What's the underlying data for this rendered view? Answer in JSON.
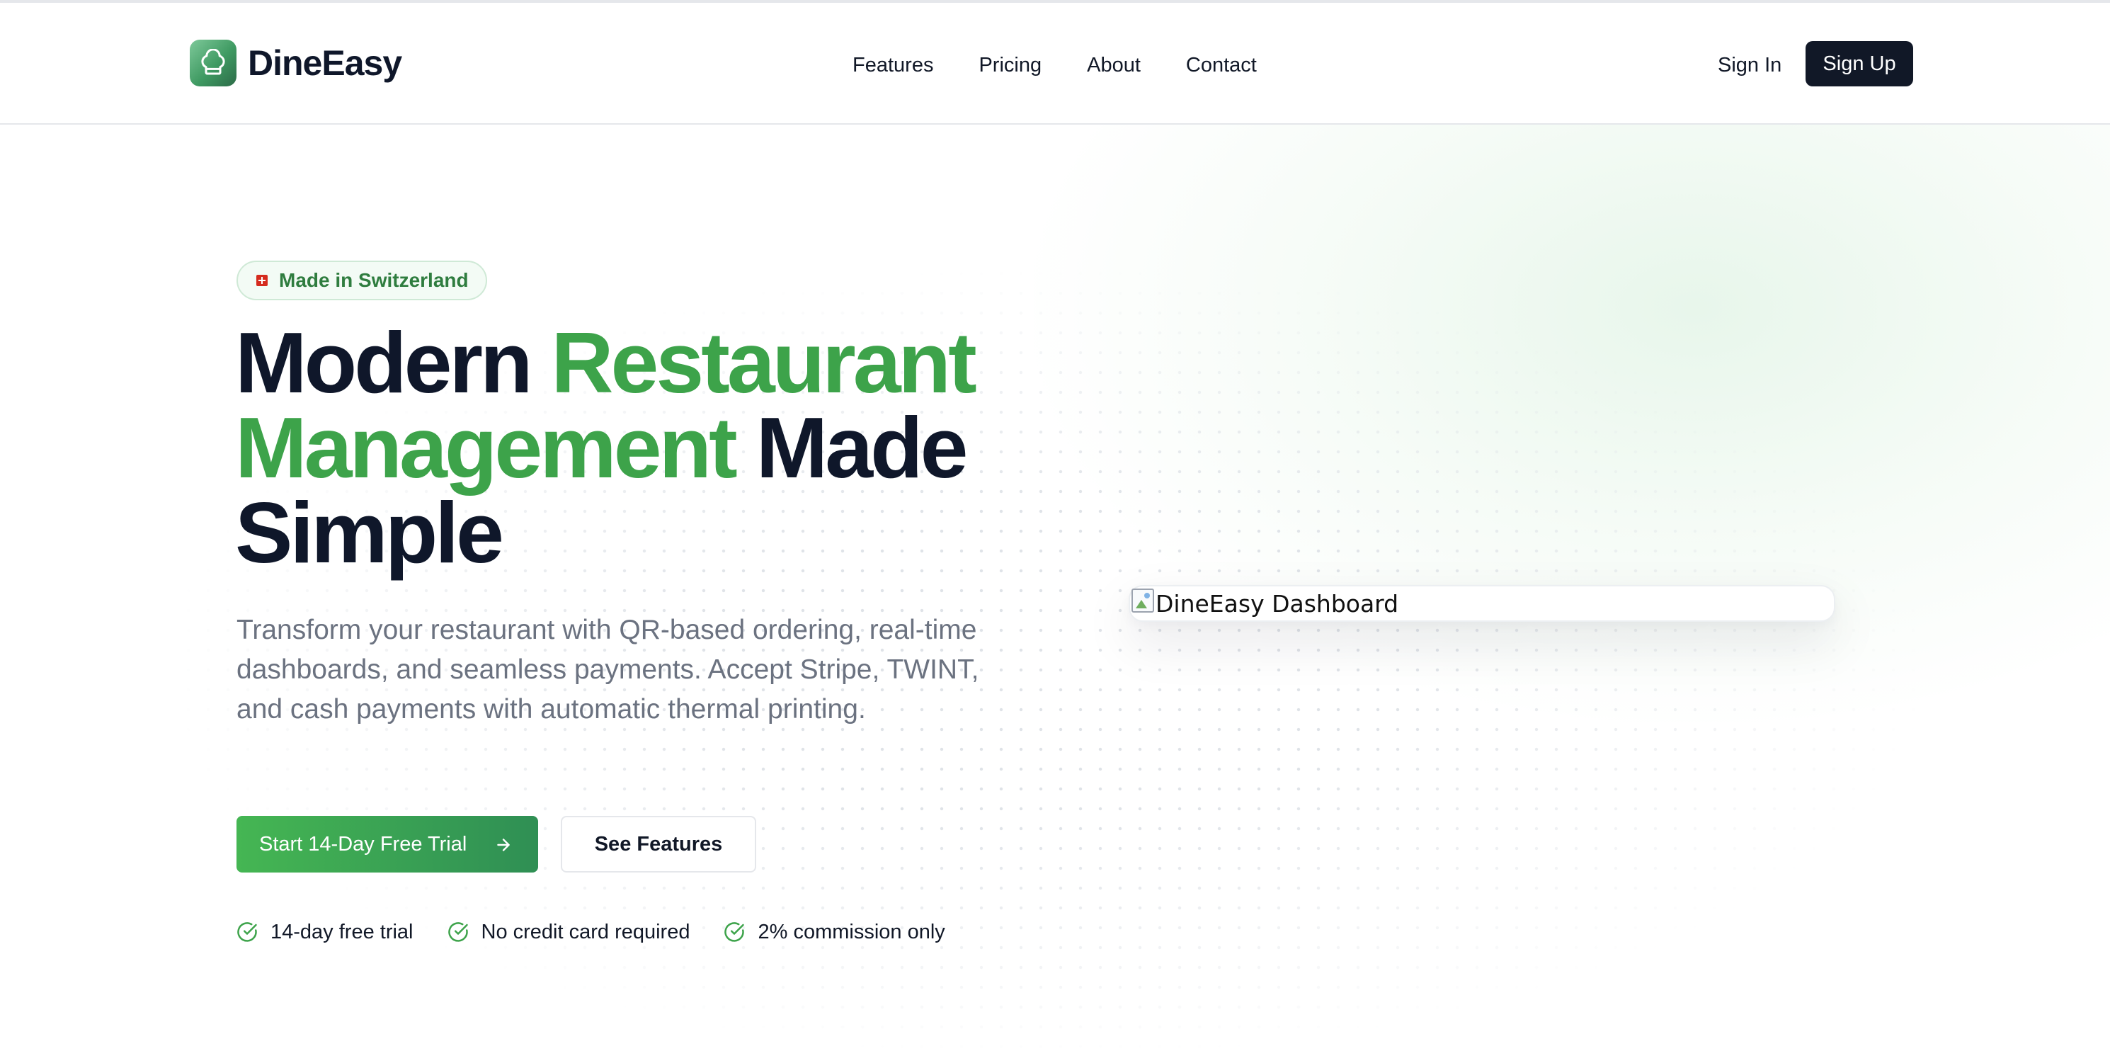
{
  "brand": {
    "name": "DineEasy",
    "logo_icon": "chef-hat-icon"
  },
  "nav": {
    "items": [
      {
        "label": "Features"
      },
      {
        "label": "Pricing"
      },
      {
        "label": "About"
      },
      {
        "label": "Contact"
      }
    ],
    "sign_in": "Sign In",
    "sign_up": "Sign Up"
  },
  "hero": {
    "badge": {
      "flag_icon": "swiss-flag-icon",
      "text": "Made in Switzerland"
    },
    "headline": {
      "line1_dark": "Modern ",
      "line1_green": "Restaurant",
      "line2_green": "Management",
      "line2_dark": " Made",
      "line3_dark": "Simple"
    },
    "subtitle": "Transform your restaurant with QR-based ordering, real-time dashboards, and seamless payments. Accept Stripe, TWINT, and cash payments with automatic thermal printing.",
    "primary_cta": {
      "label": "Start 14-Day Free Trial",
      "icon": "arrow-right-icon"
    },
    "secondary_cta": {
      "label": "See Features"
    },
    "perks": [
      {
        "icon": "check-circle-icon",
        "label": "14-day free trial"
      },
      {
        "icon": "check-circle-icon",
        "label": "No credit card required"
      },
      {
        "icon": "check-circle-icon",
        "label": "2% commission only"
      }
    ],
    "dashboard_image": {
      "alt": "DineEasy Dashboard",
      "icon": "broken-image-icon"
    }
  },
  "colors": {
    "accent_green": "#3da34a",
    "dark_text": "#0f172a",
    "muted_text": "#6b7280",
    "cta_gradient_start": "#45b653",
    "cta_gradient_end": "#2f8f54",
    "signup_bg": "#111827"
  }
}
